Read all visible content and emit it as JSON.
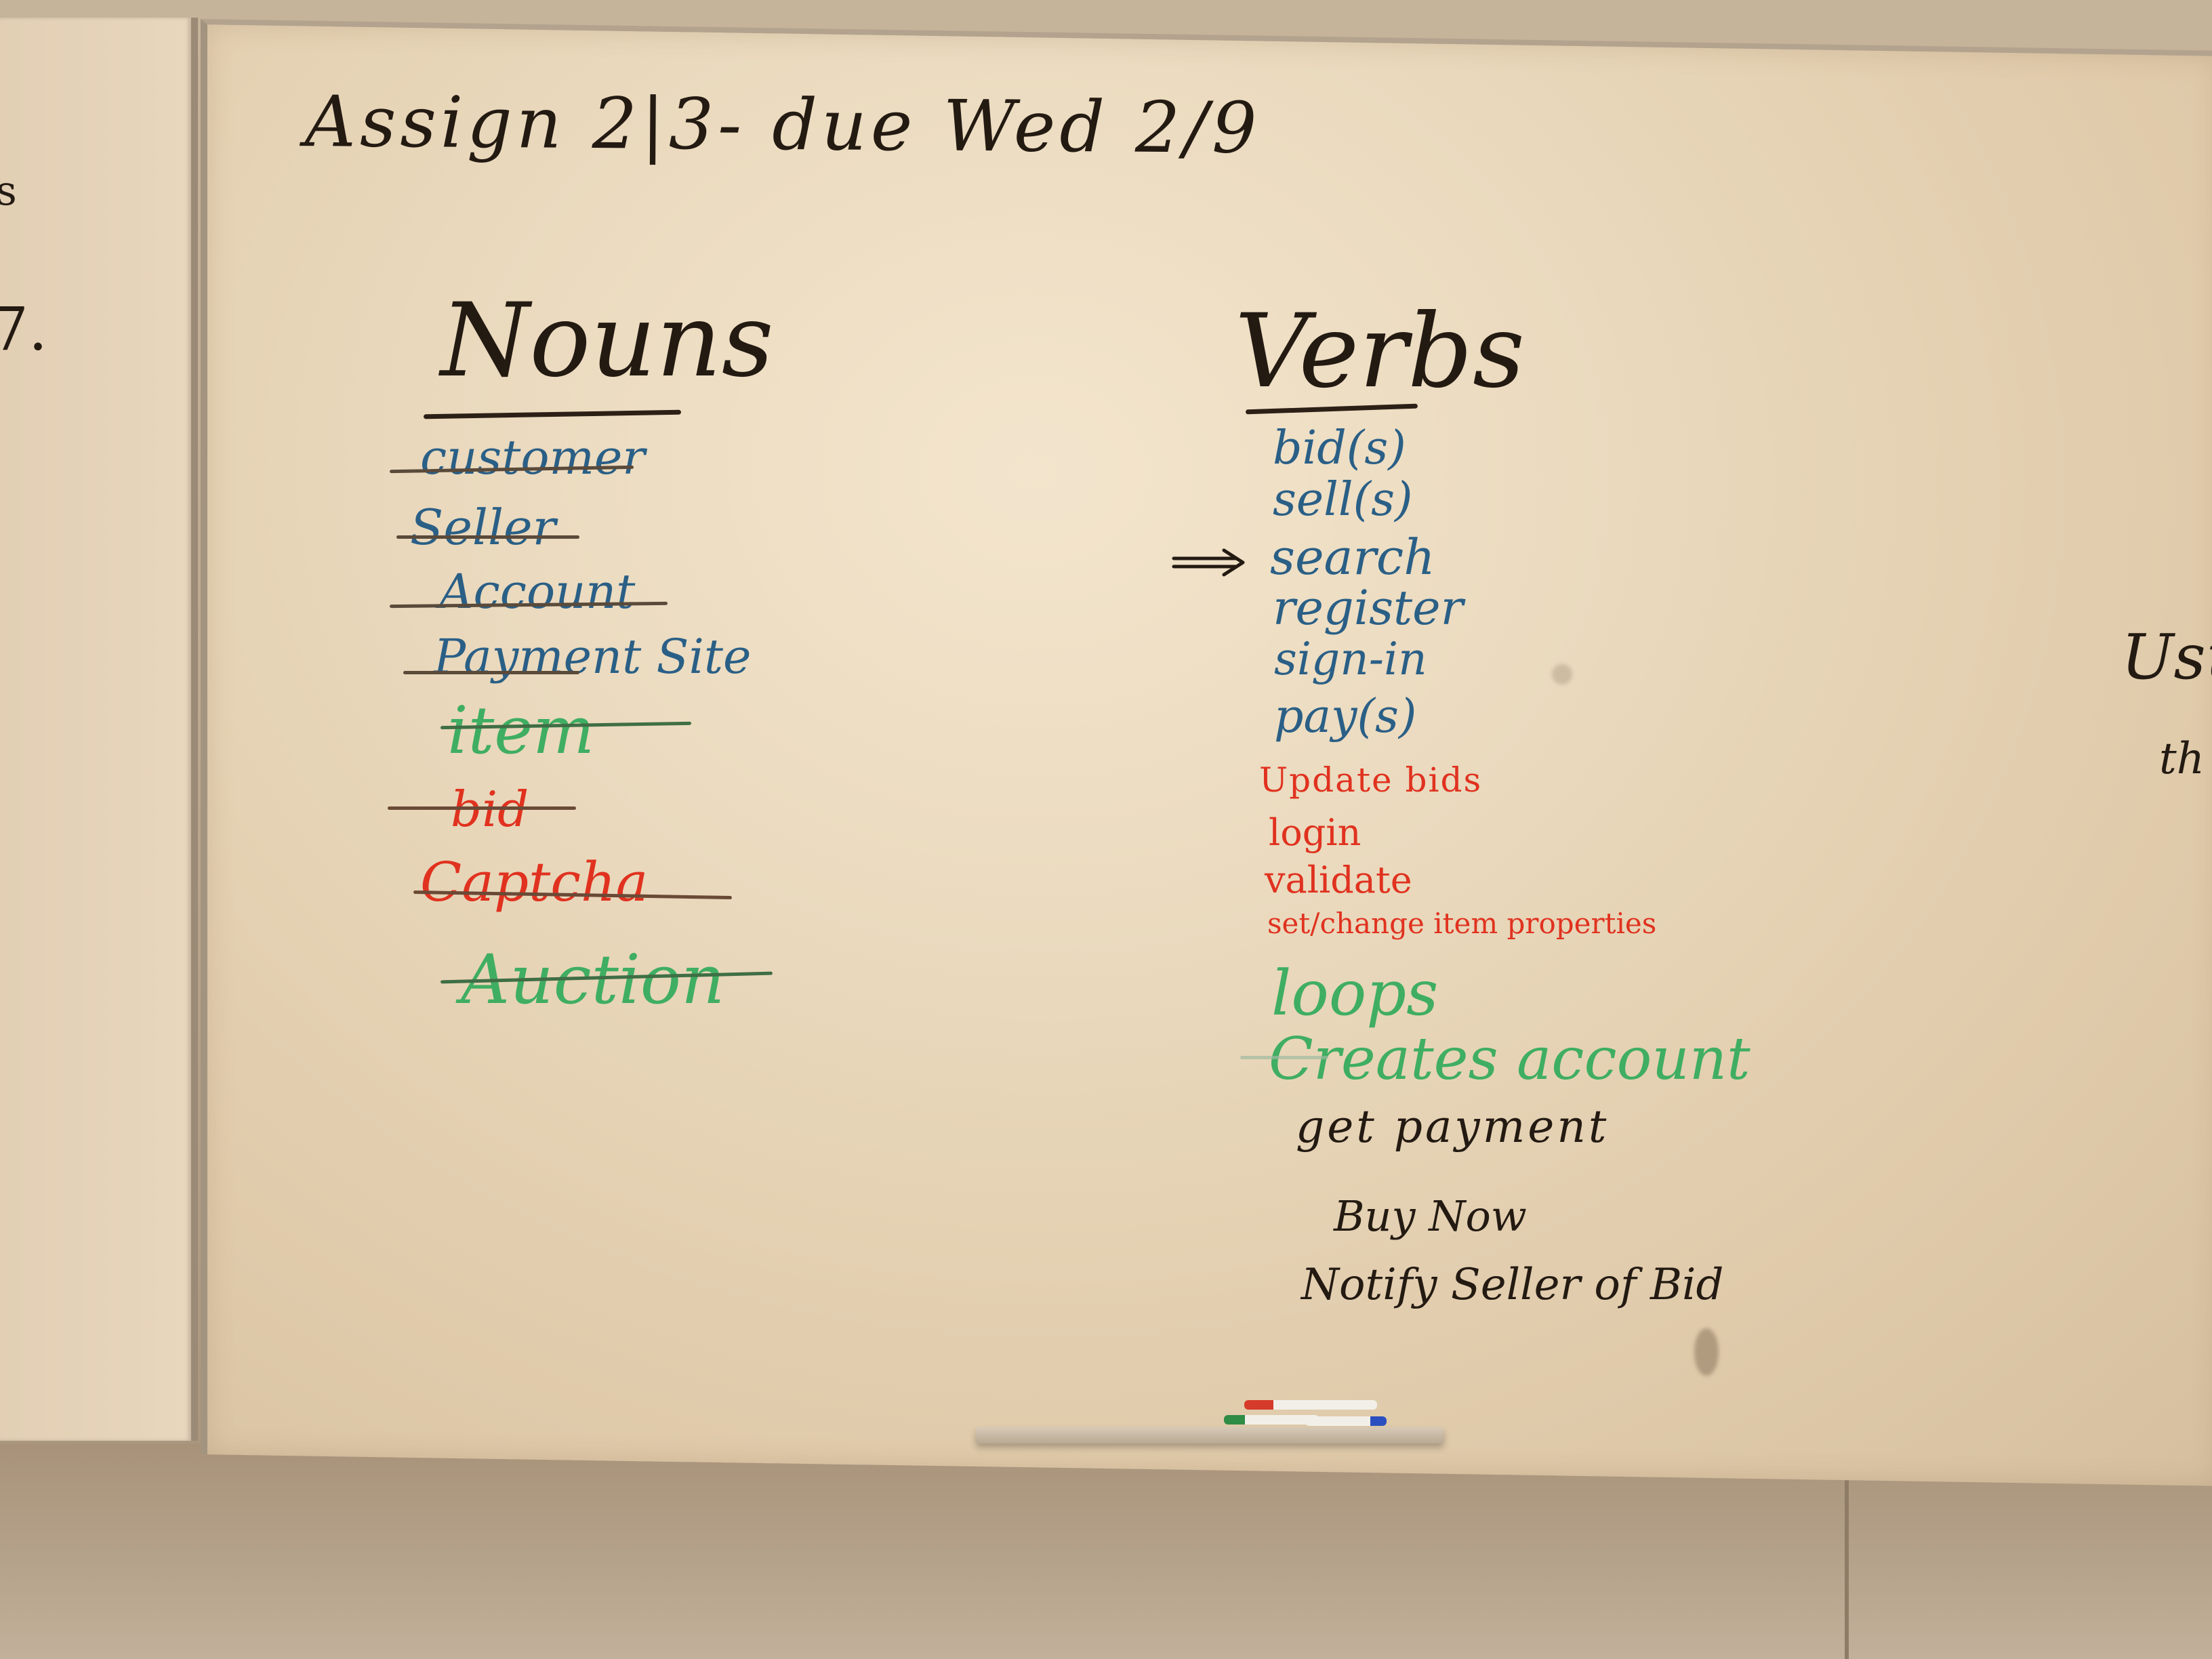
{
  "board": {
    "header": "Assign 2|3- due Wed 2/9",
    "left_panel_fragments": [
      "s",
      "7."
    ],
    "right_edge_fragments": [
      "Usu",
      "th"
    ]
  },
  "nouns": {
    "heading": "Nouns",
    "items": [
      {
        "text": "customer",
        "color": "#2a5f86",
        "crossed_out": true
      },
      {
        "text": "Seller",
        "color": "#2a5f86",
        "crossed_out": true
      },
      {
        "text": "Account",
        "color": "#2a5f86",
        "crossed_out": true
      },
      {
        "text": "Payment Site",
        "color": "#2a5f86",
        "crossed_out": true
      },
      {
        "text": "item",
        "color": "#3fae62",
        "crossed_out": true
      },
      {
        "text": "bid",
        "color": "#e0321f",
        "crossed_out": true
      },
      {
        "text": "Captcha",
        "color": "#e0321f",
        "crossed_out": true
      },
      {
        "text": "Auction",
        "color": "#3fae62",
        "crossed_out": true
      }
    ]
  },
  "verbs": {
    "heading": "Verbs",
    "arrow_marks": "search",
    "items": [
      {
        "text": "bid(s)",
        "color": "#2a5f86"
      },
      {
        "text": "sell(s)",
        "color": "#2a5f86"
      },
      {
        "text": "search",
        "color": "#2a5f86"
      },
      {
        "text": "register",
        "color": "#2a5f86"
      },
      {
        "text": "sign-in",
        "color": "#2a5f86"
      },
      {
        "text": "pay(s)",
        "color": "#2a5f86"
      },
      {
        "text": "Update bids",
        "color": "#e0321f"
      },
      {
        "text": "login",
        "color": "#e0321f"
      },
      {
        "text": "validate",
        "color": "#e0321f"
      },
      {
        "text": "set/change item properties",
        "color": "#e0321f"
      },
      {
        "text": "loops",
        "color": "#3fae62"
      },
      {
        "text": "Creates account",
        "color": "#3fae62"
      },
      {
        "text": "get payment",
        "color": "#231a12"
      },
      {
        "text": "Buy Now",
        "color": "#231a12"
      },
      {
        "text": "Notify Seller of Bid",
        "color": "#231a12"
      }
    ]
  },
  "tray_markers": [
    "#d63a2a",
    "#2f8c45",
    "#2b4fbf",
    "#d63a2a"
  ]
}
